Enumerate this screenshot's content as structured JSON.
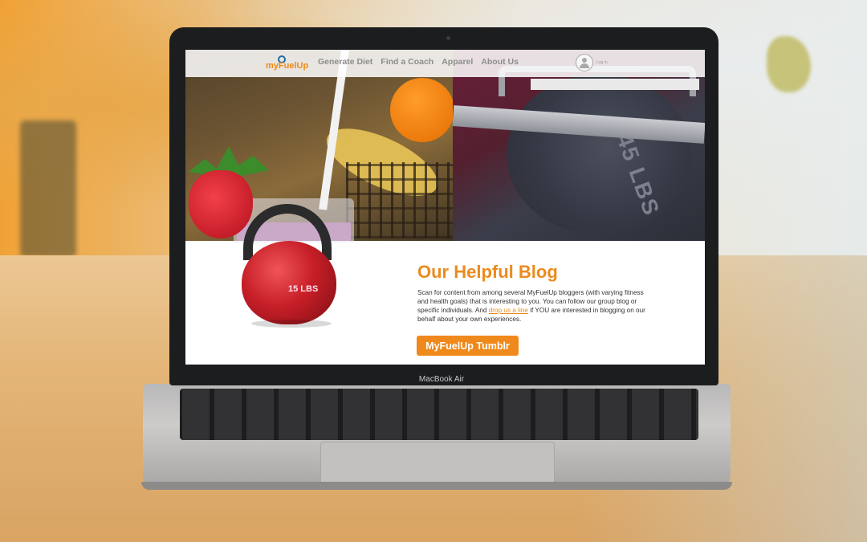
{
  "device": {
    "label": "MacBook Air"
  },
  "site": {
    "logo_text": "myFuelUp",
    "nav": [
      {
        "label": "Generate Diet"
      },
      {
        "label": "Find a Coach"
      },
      {
        "label": "Apparel"
      },
      {
        "label": "About Us"
      }
    ],
    "login_label": "Log in",
    "hero": {
      "plate_text": "45 LBS",
      "kettlebell_text": "15 LBS"
    },
    "blog": {
      "title": "Our Helpful Blog",
      "text_before_link": "Scan for content from among several MyFuelUp bloggers (with varying fitness and health goals) that is interesting to you. You can follow our group blog or specific individuals. And ",
      "link_text": "drop us a line",
      "text_after_link": " if YOU are interested in blogging on our behalf about your own experiences.",
      "button_label": "MyFuelUp Tumblr"
    }
  },
  "colors": {
    "accent": "#f0891b",
    "nav_text": "#8d8d8d"
  }
}
